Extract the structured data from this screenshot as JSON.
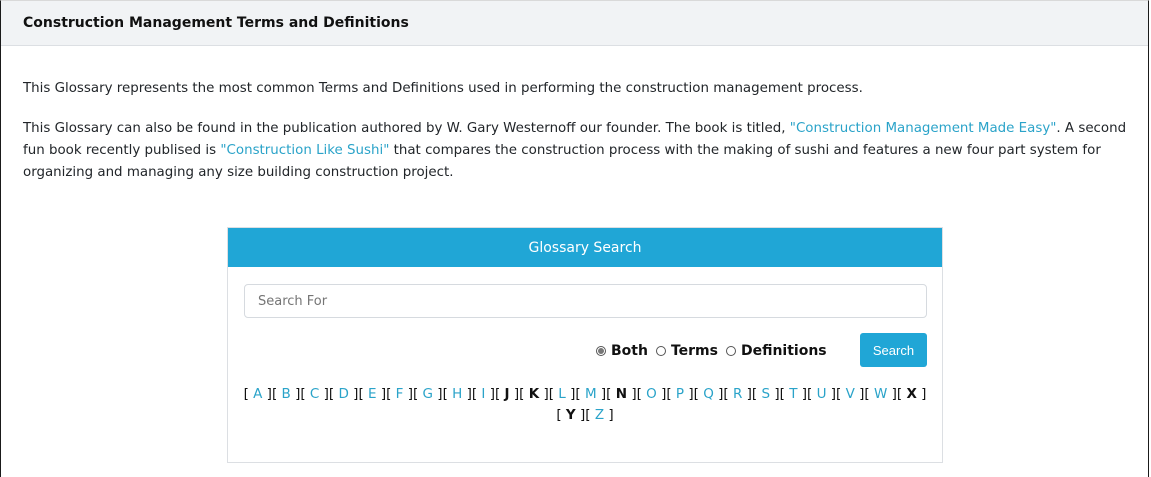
{
  "header": {
    "title": "Construction Management Terms and Definitions"
  },
  "intro": {
    "p1": "This Glossary represents the most common Terms and Definitions used in performing the construction management process.",
    "p2_a": "This Glossary can also be found in the publication authored by W. Gary Westernoff our founder. The book is titled, ",
    "book1": "\"Construction Management Made Easy\"",
    "p2_b": ". A second fun book recently publised is ",
    "book2": "\"Construction Like Sushi\"",
    "p2_c": " that compares the construction process with the making of sushi and features a new four part system for organizing and managing any size building construction project."
  },
  "search": {
    "heading": "Glossary Search",
    "placeholder": "Search For",
    "options": [
      {
        "label": "Both",
        "selected": true
      },
      {
        "label": "Terms",
        "selected": false
      },
      {
        "label": "Definitions",
        "selected": false
      }
    ],
    "button": "Search"
  },
  "letters": [
    {
      "l": "A",
      "link": true
    },
    {
      "l": "B",
      "link": true
    },
    {
      "l": "C",
      "link": true
    },
    {
      "l": "D",
      "link": true
    },
    {
      "l": "E",
      "link": true
    },
    {
      "l": "F",
      "link": true
    },
    {
      "l": "G",
      "link": true
    },
    {
      "l": "H",
      "link": true
    },
    {
      "l": "I",
      "link": true
    },
    {
      "l": "J",
      "link": false
    },
    {
      "l": "K",
      "link": false
    },
    {
      "l": "L",
      "link": true
    },
    {
      "l": "M",
      "link": true
    },
    {
      "l": "N",
      "link": false
    },
    {
      "l": "O",
      "link": true
    },
    {
      "l": "P",
      "link": true
    },
    {
      "l": "Q",
      "link": true
    },
    {
      "l": "R",
      "link": true
    },
    {
      "l": "S",
      "link": true
    },
    {
      "l": "T",
      "link": true
    },
    {
      "l": "U",
      "link": true
    },
    {
      "l": "V",
      "link": true
    },
    {
      "l": "W",
      "link": true
    },
    {
      "l": "X",
      "link": false
    },
    {
      "l": "Y",
      "link": false
    },
    {
      "l": "Z",
      "link": true
    }
  ],
  "colors": {
    "accent": "#20a6d6",
    "link": "#2aa3c9",
    "header_bg": "#f1f3f5"
  }
}
